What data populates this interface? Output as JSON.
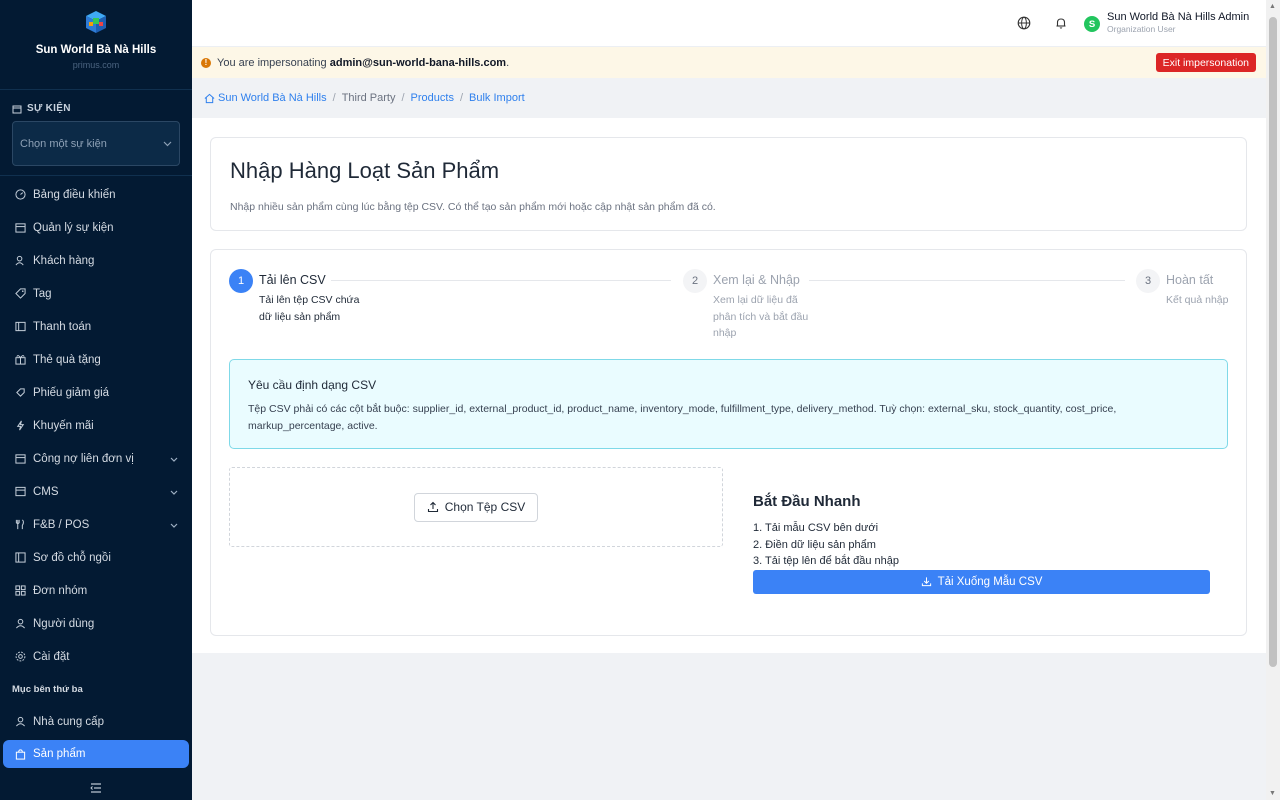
{
  "brand": {
    "name": "Sun World Bà Nà Hills",
    "sub": "primus.com"
  },
  "event_section": {
    "heading": "SỰ KIỆN",
    "placeholder": "Chọn một sự kiện"
  },
  "nav": {
    "items": [
      {
        "label": "Bảng điều khiển",
        "icon": "dashboard-icon"
      },
      {
        "label": "Quản lý sự kiện",
        "icon": "calendar-icon"
      },
      {
        "label": "Khách hàng",
        "icon": "users-icon"
      },
      {
        "label": "Tag",
        "icon": "tag-icon"
      },
      {
        "label": "Thanh toán",
        "icon": "payment-icon"
      },
      {
        "label": "Thẻ quà tặng",
        "icon": "gift-icon"
      },
      {
        "label": "Phiếu giảm giá",
        "icon": "coupon-icon"
      },
      {
        "label": "Khuyến mãi",
        "icon": "promo-icon"
      },
      {
        "label": "Công nợ liên đơn vị",
        "icon": "debt-icon"
      },
      {
        "label": "CMS",
        "icon": "cms-icon"
      },
      {
        "label": "F&B / POS",
        "icon": "fnb-icon"
      },
      {
        "label": "Sơ đồ chỗ ngồi",
        "icon": "seat-map-icon"
      },
      {
        "label": "Đơn nhóm",
        "icon": "group-order-icon"
      },
      {
        "label": "Người dùng",
        "icon": "user-icon"
      },
      {
        "label": "Cài đặt",
        "icon": "settings-icon"
      }
    ],
    "group_title": "Mục bên thứ ba",
    "third_party": [
      {
        "label": "Nhà cung cấp",
        "icon": "supplier-icon"
      },
      {
        "label": "Sản phẩm",
        "icon": "product-icon"
      }
    ]
  },
  "header": {
    "user_name": "Sun World Bà Nà Hills Admin",
    "user_role": "Organization User",
    "avatar_letter": "S"
  },
  "banner": {
    "prefix": "You are impersonating",
    "email": "admin@sun-world-bana-hills.com",
    "suffix": ".",
    "exit_label": "Exit impersonation"
  },
  "breadcrumb": {
    "home": "Sun World Bà Nà Hills",
    "b2": "Third Party",
    "b3": "Products",
    "b4": "Bulk Import"
  },
  "page": {
    "title": "Nhập Hàng Loạt Sản Phẩm",
    "description": "Nhập nhiều sản phẩm cùng lúc bằng tệp CSV. Có thể tạo sản phẩm mới hoặc cập nhật sản phẩm đã có."
  },
  "steps": [
    {
      "num": "1",
      "title": "Tải lên CSV",
      "desc1": "Tải lên tệp CSV chứa",
      "desc2": "dữ liệu sản phẩm"
    },
    {
      "num": "2",
      "title": "Xem lại & Nhập",
      "desc1": "Xem lại dữ liệu đã",
      "desc2": "phân tích và bắt đầu",
      "desc3": "nhập"
    },
    {
      "num": "3",
      "title": "Hoàn tất",
      "desc1": "Kết quả nhập"
    }
  ],
  "csv_info": {
    "title": "Yêu cầu định dạng CSV",
    "text": "Tệp CSV phải có các cột bắt buộc: supplier_id, external_product_id, product_name, inventory_mode, fulfillment_type, delivery_method. Tuỳ chọn: external_sku, stock_quantity, cost_price, markup_percentage, active."
  },
  "upload": {
    "button": "Chọn Tệp CSV"
  },
  "quick_start": {
    "title": "Bắt Đầu Nhanh",
    "steps": [
      "1. Tải mẫu CSV bên dưới",
      "2. Điền dữ liệu sản phẩm",
      "3. Tải tệp lên để bắt đầu nhập"
    ],
    "download_label": "Tải Xuống Mẫu CSV"
  },
  "colors": {
    "sidebar": "#031a33",
    "primary": "#3b82f6",
    "danger": "#dc2626",
    "info_bg": "#eafcff"
  }
}
